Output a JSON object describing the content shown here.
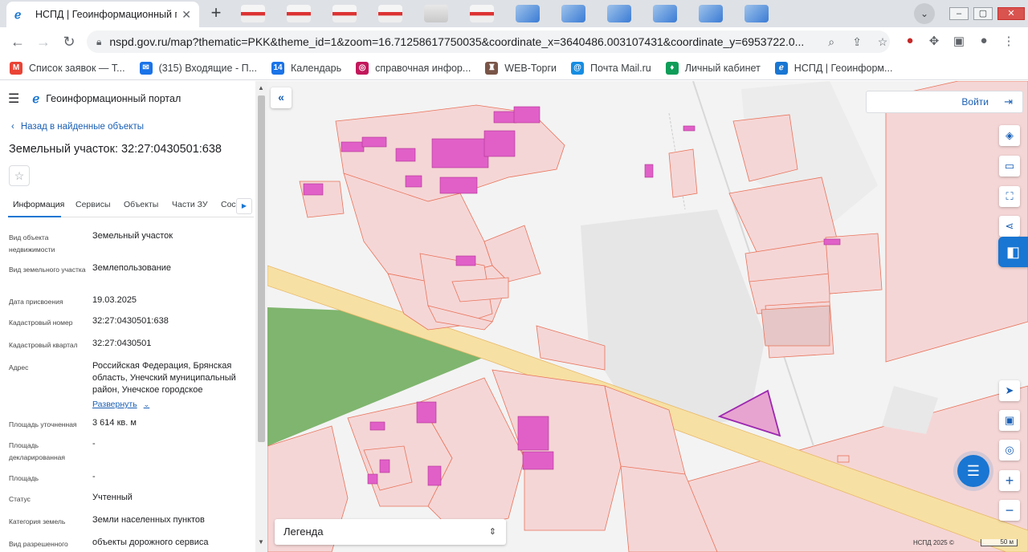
{
  "browser": {
    "tab_title": "НСПД | Геоинформационный п",
    "url": "nspd.gov.ru/map?thematic=PKK&theme_id=1&zoom=16.71258617750035&coordinate_x=3640486.003107431&coordinate_y=6953722.0...",
    "bookmarks": [
      {
        "label": "Список заявок — Т...",
        "icon": "gmail-icon",
        "color": "#ea4335"
      },
      {
        "label": "(315) Входящие - П...",
        "icon": "mail-icon",
        "color": "#1a73e8"
      },
      {
        "label": "Календарь",
        "icon": "calendar-icon",
        "color": "#1a73e8"
      },
      {
        "label": "справочная инфор...",
        "icon": "info-icon",
        "color": "#c2185b"
      },
      {
        "label": "WEB-Торги",
        "icon": "auction-icon",
        "color": "#795548"
      },
      {
        "label": "Почта Mail.ru",
        "icon": "mailru-icon",
        "color": "#168de2"
      },
      {
        "label": "Личный кабинет",
        "icon": "cabinet-icon",
        "color": "#0f9d58"
      },
      {
        "label": "НСПД | Геоинформ...",
        "icon": "nspd-icon",
        "color": "#1976d2"
      }
    ]
  },
  "panel": {
    "app_title": "Геоинформационный портал",
    "back_label": "Назад в найденные объекты",
    "object_title": "Земельный участок: 32:27:0430501:638",
    "tabs": [
      "Информация",
      "Сервисы",
      "Объекты",
      "Части ЗУ",
      "Сос"
    ],
    "fields": [
      {
        "key": "Вид объекта недвижимости",
        "value": "Земельный участок"
      },
      {
        "key": "Вид земельного участка",
        "value": "Землепользование"
      },
      {
        "key": "Дата присвоения",
        "value": "19.03.2025"
      },
      {
        "key": "Кадастровый номер",
        "value": "32:27:0430501:638"
      },
      {
        "key": "Кадастровый квартал",
        "value": "32:27:0430501"
      },
      {
        "key": "Адрес",
        "value": "Российская Федерация, Брянская область, Унечский муниципальный район, Унечское городское"
      },
      {
        "key": "Площадь уточненная",
        "value": "3 614 кв. м"
      },
      {
        "key": "Площадь декларированная",
        "value": "-"
      },
      {
        "key": "Площадь",
        "value": "-"
      },
      {
        "key": "Статус",
        "value": "Учтенный"
      },
      {
        "key": "Категория земель",
        "value": "Земли населенных пунктов"
      },
      {
        "key": "Вид разрешенного",
        "value": "объекты дорожного сервиса"
      }
    ],
    "expand_label": "Развернуть"
  },
  "map": {
    "login_label": "Войти",
    "legend_label": "Легенда",
    "copyright": "НСПД 2025 ©",
    "scale_label": "50 м",
    "colors": {
      "parcel_fill": "#f5d6d6",
      "parcel_stroke": "#e8735a",
      "building": "#e060c8",
      "road": "#f7e0a3",
      "forest": "#7fb56e",
      "selected": "#9c27b0"
    }
  }
}
